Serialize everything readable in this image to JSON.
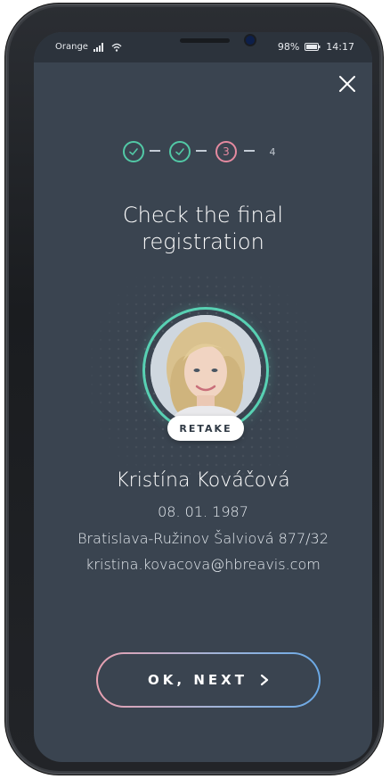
{
  "status": {
    "carrier": "Orange",
    "battery": "98%",
    "time": "14:17"
  },
  "stepper": {
    "steps": [
      {
        "state": "done",
        "label": "✓"
      },
      {
        "state": "done",
        "label": "✓"
      },
      {
        "state": "current",
        "label": "3"
      },
      {
        "state": "todo",
        "label": "4"
      }
    ]
  },
  "title_line1": "Check the final",
  "title_line2": "registration",
  "retake_label": "RETAKE",
  "profile": {
    "name": "Kristína Kováčová",
    "dob": "08. 01. 1987",
    "address": "Bratislava-Ružinov Šalviová 877/32",
    "email": "kristina.kovacova@hbreavis.com"
  },
  "next_label": "OK, NEXT",
  "icons": {
    "close": "close-icon",
    "check": "check-icon",
    "chevron": "chevron-right-icon"
  },
  "colors": {
    "background": "#3a4450",
    "accent_green": "#52c9a6",
    "accent_pink": "#e58aa0",
    "accent_blue": "#6aa9e6"
  }
}
